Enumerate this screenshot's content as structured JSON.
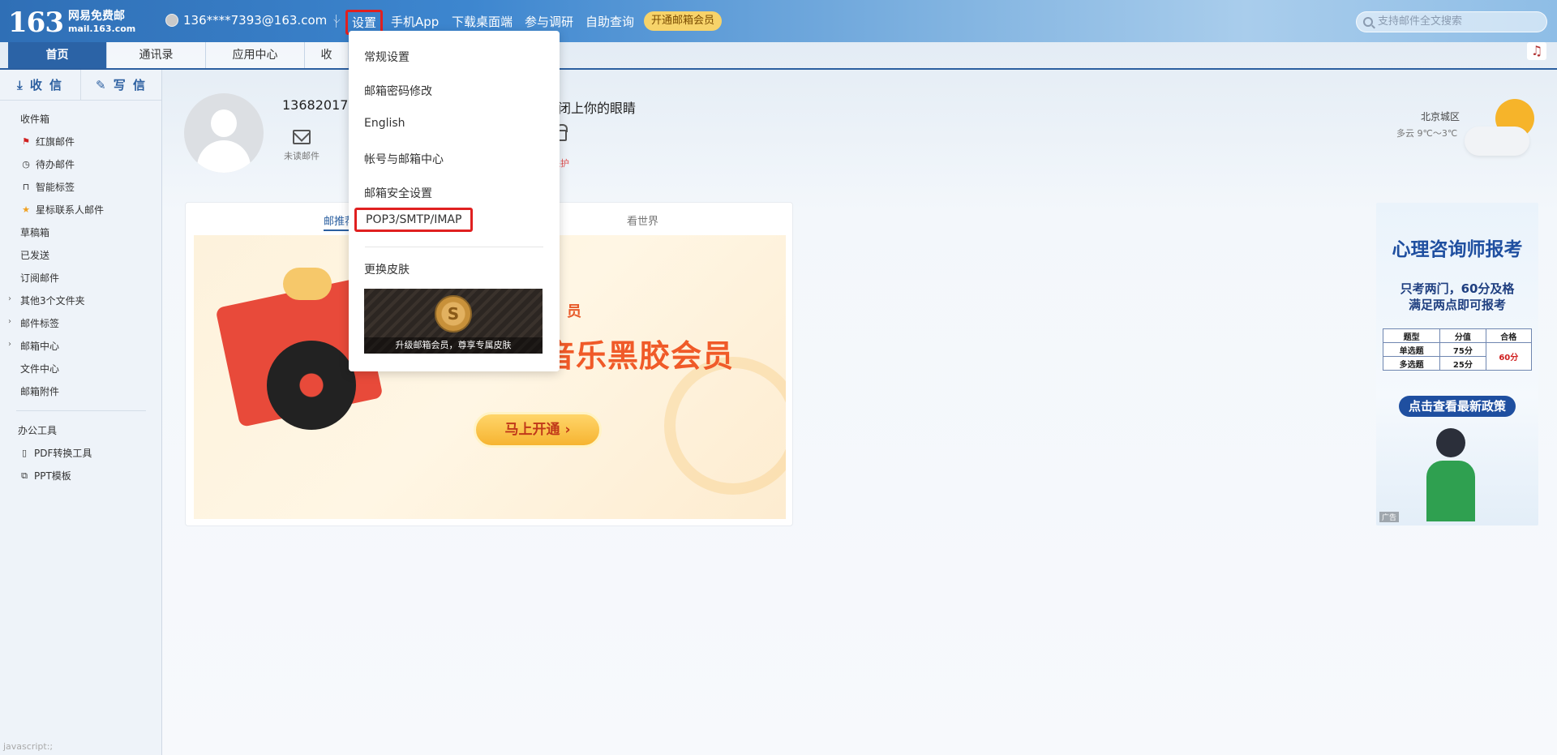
{
  "header": {
    "logo_number": "163",
    "logo_name": "网易免费邮",
    "logo_domain": "mail.163.com",
    "account": "136****7393@163.com",
    "nav": [
      "设置",
      "手机App",
      "下载桌面端",
      "参与调研",
      "自助查询"
    ],
    "vip_button": "开通邮箱会员",
    "search_placeholder": "支持邮件全文搜索"
  },
  "tabs": [
    "首页",
    "通讯录",
    "应用中心",
    "收"
  ],
  "sidebar": {
    "receive": "收 信",
    "compose": "写 信",
    "folders": [
      "收件箱",
      "红旗邮件",
      "待办邮件",
      "智能标签",
      "星标联系人邮件",
      "草稿箱",
      "已发送",
      "订阅邮件",
      "其他3个文件夹",
      "邮件标签",
      "邮箱中心",
      "文件中心",
      "邮箱附件"
    ],
    "tools_title": "办公工具",
    "tools": [
      "PDF转换工具",
      "PPT模板"
    ],
    "status": "javascript:;"
  },
  "profile": {
    "username": "13682017",
    "motto": "轻轻闭上你的眼睛",
    "unread_label": "未读邮件",
    "protect_label": "保护"
  },
  "weather": {
    "city": "北京城区",
    "forecast": "多云 9℃～3℃"
  },
  "card": {
    "tab_left": "邮推荐",
    "tab_right": "看世界",
    "banner_sub": "员",
    "banner_title": "音乐黑胶会员",
    "banner_button": "马上开通 ›"
  },
  "ad": {
    "title": "心理咨询师报考",
    "line1": "只考两门，60分及格",
    "line2": "满足两点即可报考",
    "table_header": [
      "题型",
      "分值",
      "合格"
    ],
    "row1": [
      "单选题",
      "75分"
    ],
    "row2": [
      "多选题",
      "25分"
    ],
    "pass_score": "60分",
    "button": "点击查看最新政策",
    "label": "广告"
  },
  "dropdown": {
    "items": [
      "常规设置",
      "邮箱密码修改",
      "English",
      "帐号与邮箱中心",
      "邮箱安全设置",
      "POP3/SMTP/IMAP",
      "更换皮肤"
    ],
    "skin_promo": "升级邮箱会员，尊享专属皮肤"
  }
}
